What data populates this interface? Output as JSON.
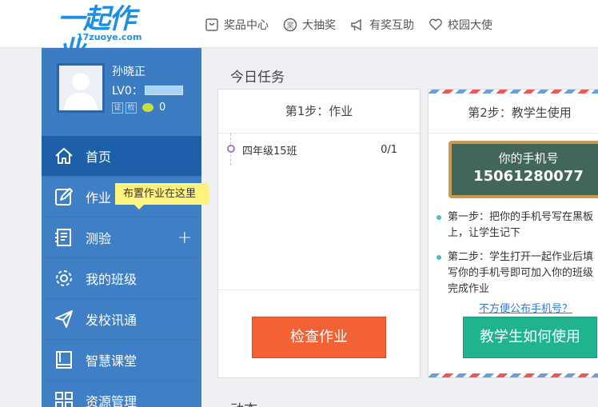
{
  "header": {
    "logo_main": "一起作业",
    "logo_sub": "17zuoye.com",
    "nav": [
      {
        "label": "奖品中心",
        "icon": "gift-box-icon"
      },
      {
        "label": "大抽奖",
        "icon": "lottery-icon"
      },
      {
        "label": "有奖互助",
        "icon": "megaphone-icon"
      },
      {
        "label": "校园大使",
        "icon": "heart-icon"
      }
    ]
  },
  "profile": {
    "name": "孙晓正",
    "level_label": "LV0：",
    "badge1": "证",
    "badge2": "检",
    "coins": "0"
  },
  "sidebar": {
    "items": [
      {
        "label": "首页",
        "icon": "home-icon"
      },
      {
        "label": "作业",
        "icon": "edit-icon"
      },
      {
        "label": "测验",
        "icon": "quiz-icon"
      },
      {
        "label": "我的班级",
        "icon": "gear-icon"
      },
      {
        "label": "发校讯通",
        "icon": "send-icon"
      },
      {
        "label": "智慧课堂",
        "icon": "book-icon"
      },
      {
        "label": "资源管理",
        "icon": "grid-icon"
      }
    ],
    "plus": "+"
  },
  "tooltip": "布置作业在这里",
  "main": {
    "today_title": "今日任务",
    "next_title": "动态",
    "step1": {
      "title": "第1步：作业",
      "tasks": [
        {
          "name": "四年级15班",
          "count": "0/1"
        }
      ],
      "button": "检查作业"
    },
    "step2": {
      "title": "第2步：教学生使用",
      "board_label": "你的手机号",
      "phone": "15061280077",
      "steps": [
        "第一步：把你的手机号写在黑板",
        "上，让学生记下",
        "第二步：学生打开一起作业后填",
        "写你的手机号即可加入你的班级",
        "完成作业"
      ],
      "link": "不方便公布手机号？",
      "button": "教学生如何使用"
    }
  },
  "colors": {
    "sidebar": "#3f7fc6",
    "sidebar_active": "#1d5fa8",
    "check_button": "#f26235",
    "teach_button": "#20b390",
    "board": "#42665a"
  }
}
